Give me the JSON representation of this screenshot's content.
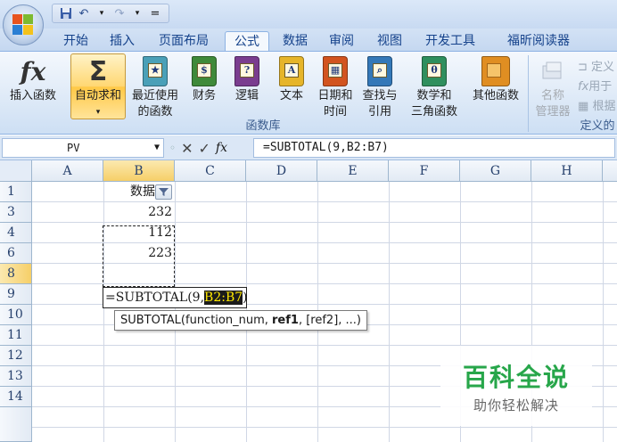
{
  "titlebar": {
    "separator": "="
  },
  "tabs": [
    {
      "label": "开始"
    },
    {
      "label": "插入"
    },
    {
      "label": "页面布局"
    },
    {
      "label": "公式",
      "active": true
    },
    {
      "label": "数据"
    },
    {
      "label": "审阅"
    },
    {
      "label": "视图"
    },
    {
      "label": "开发工具"
    },
    {
      "label": "福昕阅读器"
    }
  ],
  "ribbon": {
    "insert_function": {
      "label": "插入函数"
    },
    "autosum": {
      "label": "自动求和",
      "dropdown": "▾"
    },
    "recent": {
      "line1": "最近使用",
      "line2": "的函数"
    },
    "financial": {
      "line1": "财务"
    },
    "logical": {
      "line1": "逻辑"
    },
    "text": {
      "line1": "文本"
    },
    "datetime": {
      "line1": "日期和",
      "line2": "时间"
    },
    "lookup": {
      "line1": "查找与",
      "line2": "引用"
    },
    "math": {
      "line1": "数学和",
      "line2": "三角函数"
    },
    "more": {
      "line1": "其他函数"
    },
    "name_manager": {
      "line1": "名称",
      "line2": "管理器"
    },
    "define_name": "定义",
    "use_in_formula": "用于",
    "create_from_selection": "根据",
    "group_function_library": "函数库",
    "group_defined_names": "定义的",
    "colors": {
      "financial": "#3f8a3a",
      "logical": "#7a3d8f",
      "text": "#e6b52a",
      "datetime": "#d2541f",
      "lookup": "#3478b8",
      "math": "#2f8f5e",
      "more": "#e08e22"
    }
  },
  "formula_bar": {
    "name_box": "PV",
    "formula": "=SUBTOTAL(9,B2:B7)"
  },
  "grid": {
    "columns": [
      "A",
      "B",
      "C",
      "D",
      "E",
      "F",
      "G",
      "H"
    ],
    "rows": [
      "1",
      "3",
      "4",
      "6",
      "8",
      "9",
      "10",
      "11",
      "12",
      "13",
      "14"
    ],
    "b1": "数据",
    "values": [
      "232",
      "112",
      "223"
    ],
    "active_cell": {
      "prefix": "=SUBTOTAL(9,",
      "ref": "B2:B7",
      "suffix": ")"
    },
    "tooltip": {
      "fn": "SUBTOTAL(function_num, ",
      "bold": "ref1",
      "rest": ", [ref2], ...)"
    }
  },
  "watermark": {
    "title": "百科全说",
    "subtitle": "助你轻松解决"
  }
}
